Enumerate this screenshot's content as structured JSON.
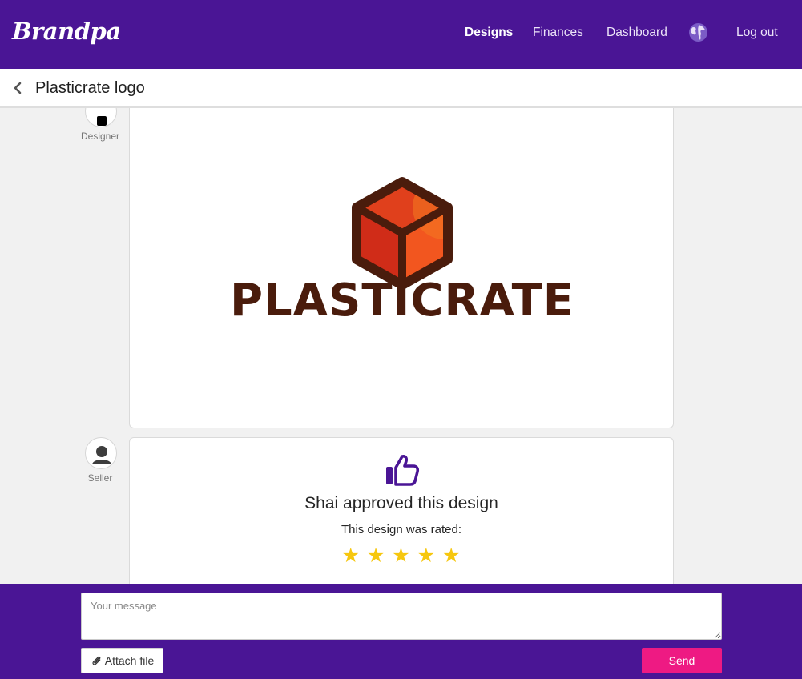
{
  "brand": {
    "name": "Brandpa"
  },
  "nav": {
    "designs": "Designs",
    "finances": "Finances",
    "dashboard": "Dashboard",
    "language_icon": "globe-icon",
    "logout": "Log out"
  },
  "page": {
    "title": "Plasticrate logo",
    "back_icon": "chevron-left-icon"
  },
  "messages": [
    {
      "role": "Designer",
      "type": "design-image",
      "logo_text": "PLASTICRATE",
      "logo_icon": "cube-icon"
    },
    {
      "role": "Seller",
      "type": "approval",
      "icon": "thumbs-up-icon",
      "title": "Shai approved this design",
      "rating_label": "This design was rated:",
      "rating": 5,
      "rating_max": 5,
      "stars": [
        "★",
        "★",
        "★",
        "★",
        "★"
      ]
    }
  ],
  "composer": {
    "placeholder": "Your message",
    "attach_label": "Attach file",
    "attach_icon": "paperclip-icon",
    "send_label": "Send"
  },
  "colors": {
    "brand_purple": "#4a1595",
    "send_pink": "#ee1a83",
    "star_yellow": "#f6c70f",
    "logo_brown": "#4a1c0c",
    "logo_red": "#e0401c",
    "logo_orange": "#f47a20"
  }
}
